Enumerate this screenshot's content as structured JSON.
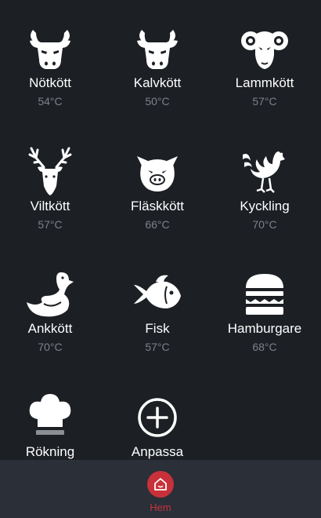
{
  "meats": [
    {
      "label": "Nötkött",
      "temp": "54°C",
      "icon": "cow-icon"
    },
    {
      "label": "Kalvkött",
      "temp": "50°C",
      "icon": "calf-icon"
    },
    {
      "label": "Lammkött",
      "temp": "57°C",
      "icon": "ram-icon"
    },
    {
      "label": "Viltkött",
      "temp": "57°C",
      "icon": "deer-icon"
    },
    {
      "label": "Fläskkött",
      "temp": "66°C",
      "icon": "pig-icon"
    },
    {
      "label": "Kyckling",
      "temp": "70°C",
      "icon": "rooster-icon"
    },
    {
      "label": "Ankkött",
      "temp": "70°C",
      "icon": "duck-icon"
    },
    {
      "label": "Fisk",
      "temp": "57°C",
      "icon": "fish-icon"
    },
    {
      "label": "Hamburgare",
      "temp": "68°C",
      "icon": "burger-icon"
    }
  ],
  "extras": [
    {
      "label": "Rökning",
      "icon": "chef-hat-icon"
    },
    {
      "label": "Anpassa",
      "icon": "plus-circle-icon"
    }
  ],
  "tabbar": {
    "home_label": "Hem",
    "home_icon": "home-icon",
    "accent": "#c8313a"
  }
}
